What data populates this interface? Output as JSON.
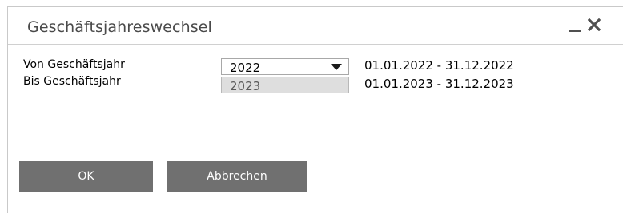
{
  "window": {
    "title": "Geschäftsjahreswechsel",
    "minimize_icon": "minimize-icon",
    "close_icon": "close-icon"
  },
  "form": {
    "from_label": "Von Geschäftsjahr",
    "from_value": "2022",
    "from_range": "01.01.2022 - 31.12.2022",
    "to_label": "Bis Geschäftsjahr",
    "to_value": "2023",
    "to_range": "01.01.2023 - 31.12.2023"
  },
  "buttons": {
    "ok_label": "OK",
    "cancel_label": "Abbrechen"
  },
  "colors": {
    "button_bg": "#707070",
    "readonly_bg": "#dedede"
  }
}
